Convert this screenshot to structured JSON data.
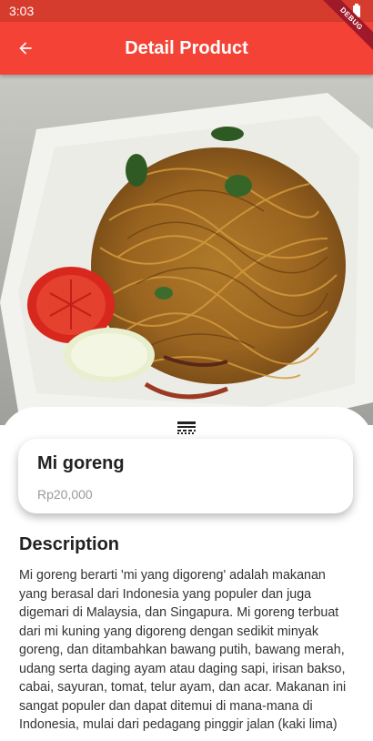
{
  "status_bar": {
    "time": "3:03",
    "debug_label": "DEBUG"
  },
  "app_bar": {
    "title": "Detail Product"
  },
  "product": {
    "name": "Mi goreng",
    "price": "Rp20,000"
  },
  "description": {
    "heading": "Description",
    "text": "Mi goreng berarti 'mi yang digoreng' adalah makanan yang berasal dari Indonesia yang populer dan juga digemari di Malaysia, dan Singapura. Mi goreng terbuat dari mi kuning yang digoreng dengan sedikit minyak goreng, dan ditambahkan bawang putih, bawang merah, udang serta daging ayam atau daging sapi, irisan bakso, cabai, sayuran, tomat, telur ayam, dan acar. Makanan ini sangat populer dan dapat ditemui di mana-mana di Indonesia, mulai dari pedagang pinggir jalan (kaki lima)"
  },
  "colors": {
    "app_bar": "#f44336",
    "status_bar": "#d63c2e",
    "price": "#9a9a9a"
  }
}
